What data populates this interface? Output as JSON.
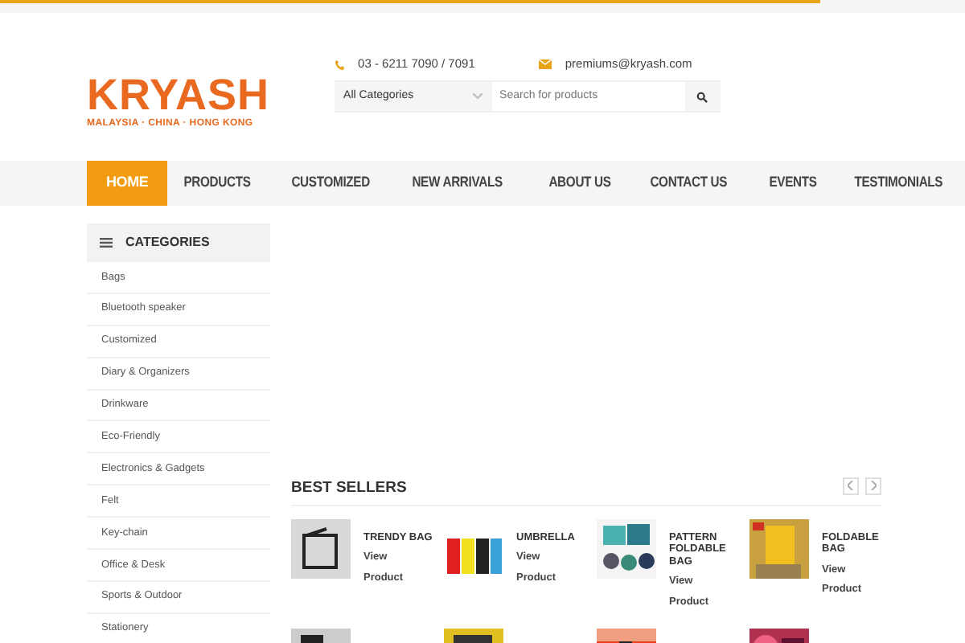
{
  "header": {
    "logo": {
      "name": "KRYASH",
      "tagline": "MALAYSIA · CHINA · HONG KONG"
    },
    "phone": "03 - 6211 7090 / 7091",
    "email": "premiums@kryash.com",
    "search": {
      "category": "All Categories",
      "placeholder": "Search for products"
    }
  },
  "nav": [
    {
      "label": "HOME",
      "selected": true
    },
    {
      "label": "PRODUCTS",
      "selected": false
    },
    {
      "label": "CUSTOMIZED",
      "selected": false
    },
    {
      "label": "NEW ARRIVALS",
      "selected": false
    },
    {
      "label": "ABOUT US",
      "selected": false
    },
    {
      "label": "CONTACT US",
      "selected": false
    },
    {
      "label": "EVENTS",
      "selected": false
    },
    {
      "label": "TESTIMONIALS",
      "selected": false
    }
  ],
  "sidebar": {
    "title": "CATEGORIES",
    "items": [
      "Bags",
      "Bluetooth speaker",
      "Customized",
      "Diary & Organizers",
      "Drinkware",
      "Eco-Friendly",
      "Electronics & Gadgets",
      "Felt",
      "Key-chain",
      "Office & Desk",
      "Sports & Outdoor",
      "Stationery"
    ]
  },
  "best_sellers": {
    "title": "BEST SELLERS",
    "products": [
      {
        "kind": "product",
        "name": "TRENDY BAG",
        "link": "View Product"
      },
      {
        "kind": "product",
        "name": "UMBRELLA",
        "link": "View Product"
      },
      {
        "kind": "product",
        "name": "PATTERN FOLDABLE BAG",
        "link": "View Product"
      },
      {
        "kind": "product",
        "name": "FOLDABLE BAG",
        "link": "View Product"
      },
      {
        "kind": "picture"
      },
      {
        "kind": "picture"
      },
      {
        "kind": "picture"
      },
      {
        "kind": "picture"
      }
    ]
  }
}
